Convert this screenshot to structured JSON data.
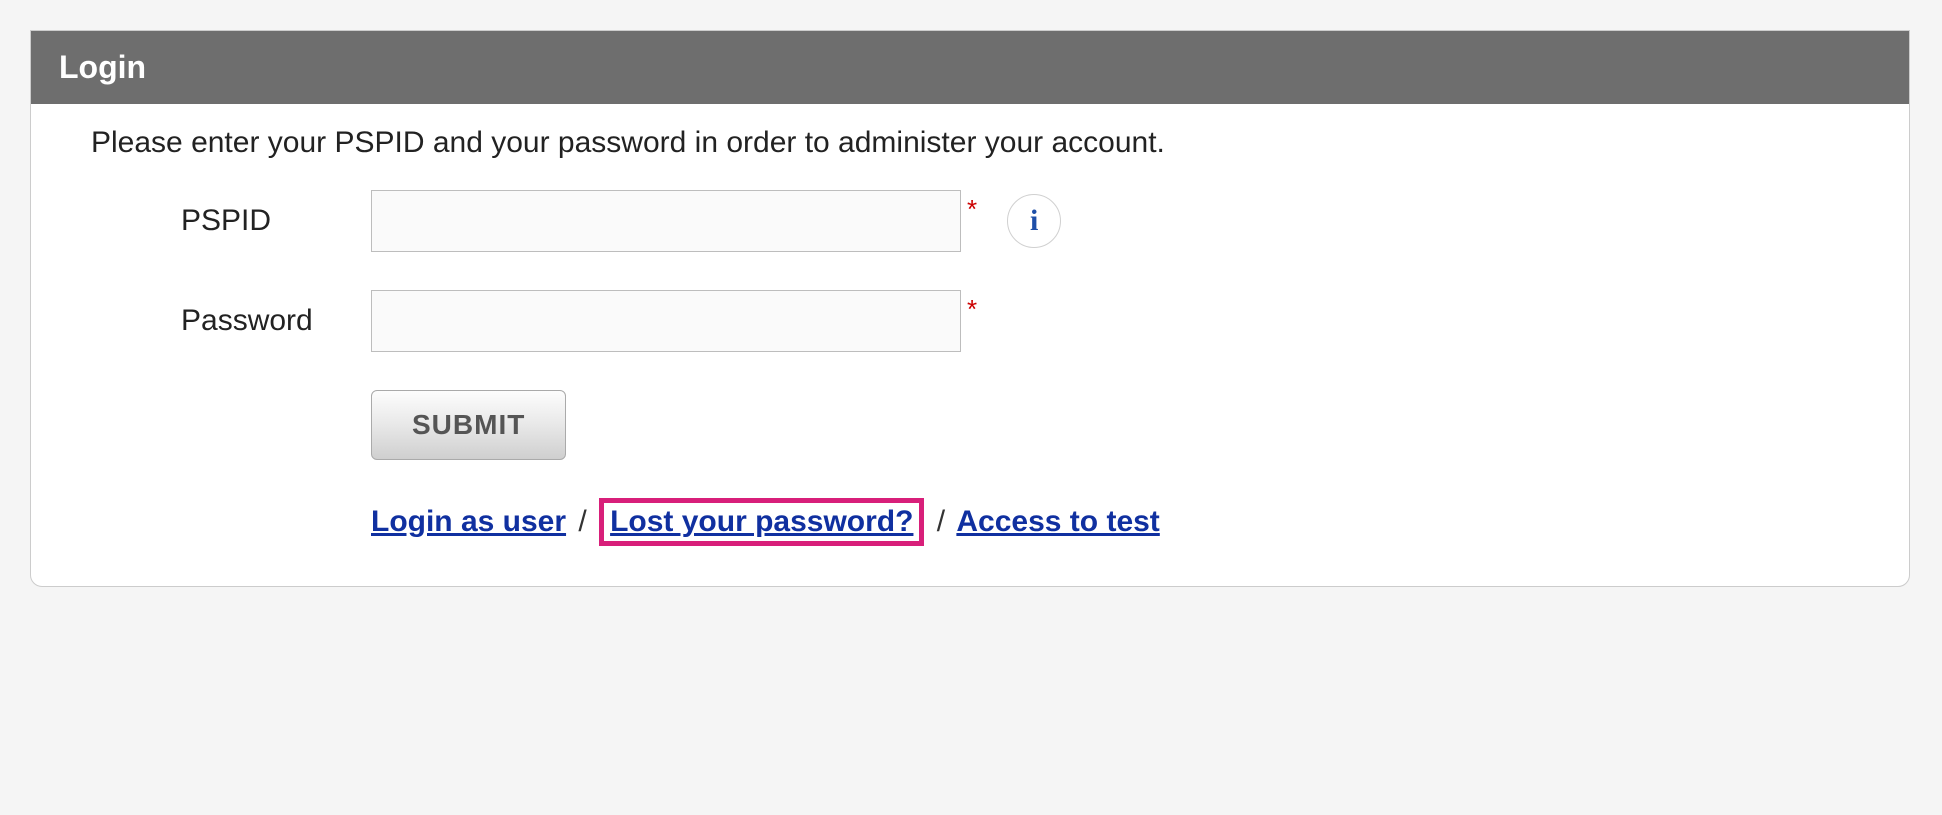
{
  "header": {
    "title": "Login"
  },
  "instructions": "Please enter your PSPID and your password in order to administer your account.",
  "form": {
    "pspid": {
      "label": "PSPID",
      "value": "",
      "required_marker": "*",
      "info_icon": "i"
    },
    "password": {
      "label": "Password",
      "value": "",
      "required_marker": "*"
    },
    "submit_label": "SUBMIT"
  },
  "links": {
    "login_as_user": "Login as user",
    "lost_password": "Lost your password?",
    "access_to_test": "Access to test",
    "separator": "/"
  }
}
